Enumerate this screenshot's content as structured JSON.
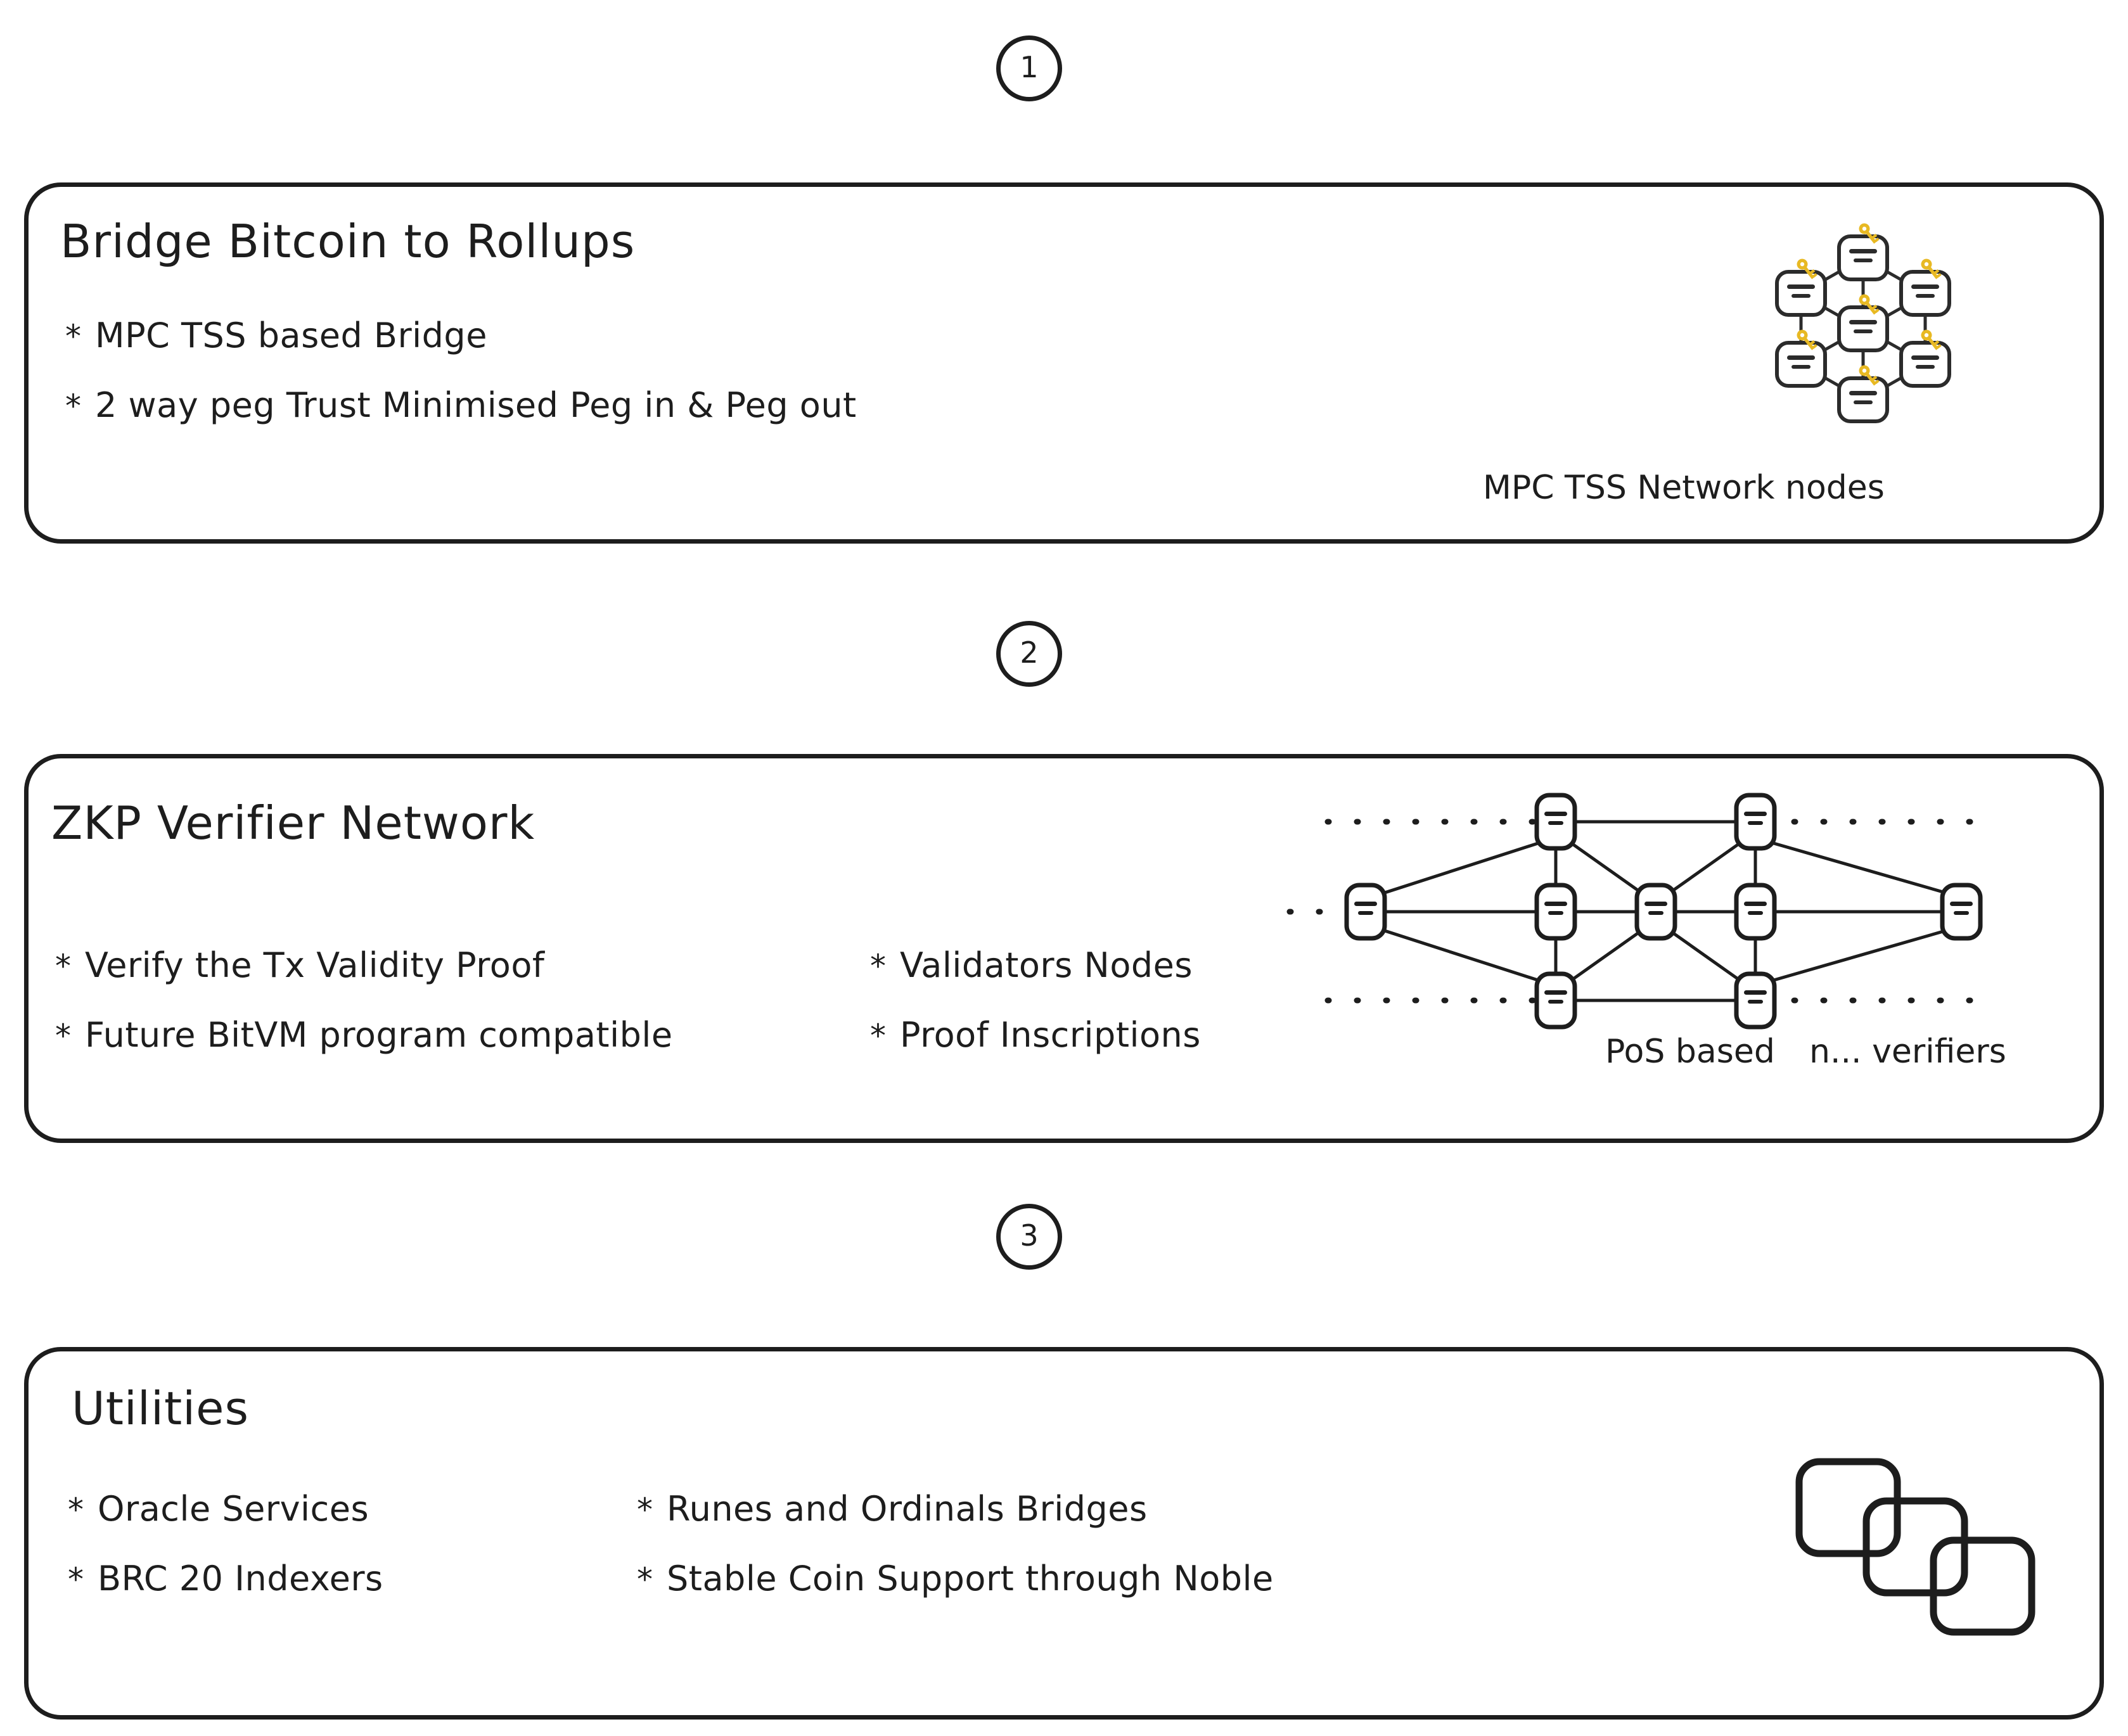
{
  "theme": {
    "stroke": "#1d1d1d",
    "background": "#ffffff",
    "key_icon_color": "#e8b923"
  },
  "steps": [
    {
      "number": "1"
    },
    {
      "number": "2"
    },
    {
      "number": "3"
    }
  ],
  "cards": [
    {
      "id": "card-1",
      "title": "Bridge Bitcoin to Rollups",
      "bullets_left": [
        {
          "mark": "*",
          "text": "MPC TSS based Bridge"
        },
        {
          "mark": "*",
          "text": "2 way peg Trust Minimised Peg in & Peg out"
        }
      ],
      "bullets_right": [],
      "figure": {
        "name": "mpc-tss-network-illustration",
        "caption": "MPC TSS Network nodes",
        "node_count": 7,
        "node_icon": "server-node-icon",
        "decoration": "key-icon"
      }
    },
    {
      "id": "card-2",
      "title": "ZKP Verifier Network",
      "bullets_left": [
        {
          "mark": "*",
          "text": "Verify the Tx Validity Proof"
        },
        {
          "mark": "*",
          "text": "Future BitVM program compatible"
        }
      ],
      "bullets_right": [
        {
          "mark": "*",
          "text": "Validators Nodes"
        },
        {
          "mark": "*",
          "text": "Proof Inscriptions"
        }
      ],
      "figure": {
        "name": "pos-verifier-mesh-illustration",
        "caption_left": "PoS based",
        "caption_right": "n... verifiers",
        "node_count": 9,
        "node_icon": "server-node-icon",
        "decoration": "dotted-line"
      }
    },
    {
      "id": "card-3",
      "title": "Utilities",
      "bullets_left": [
        {
          "mark": "*",
          "text": "Oracle Services"
        },
        {
          "mark": "*",
          "text": "BRC 20 Indexers"
        }
      ],
      "bullets_right": [
        {
          "mark": "*",
          "text": "Runes and Ordinals Bridges"
        },
        {
          "mark": "*",
          "text": "Stable Coin Support through Noble"
        }
      ],
      "figure": {
        "name": "stacked-squares-illustration",
        "caption": "",
        "node_count": 3,
        "node_icon": "rounded-square-icon",
        "decoration": "none"
      }
    }
  ]
}
